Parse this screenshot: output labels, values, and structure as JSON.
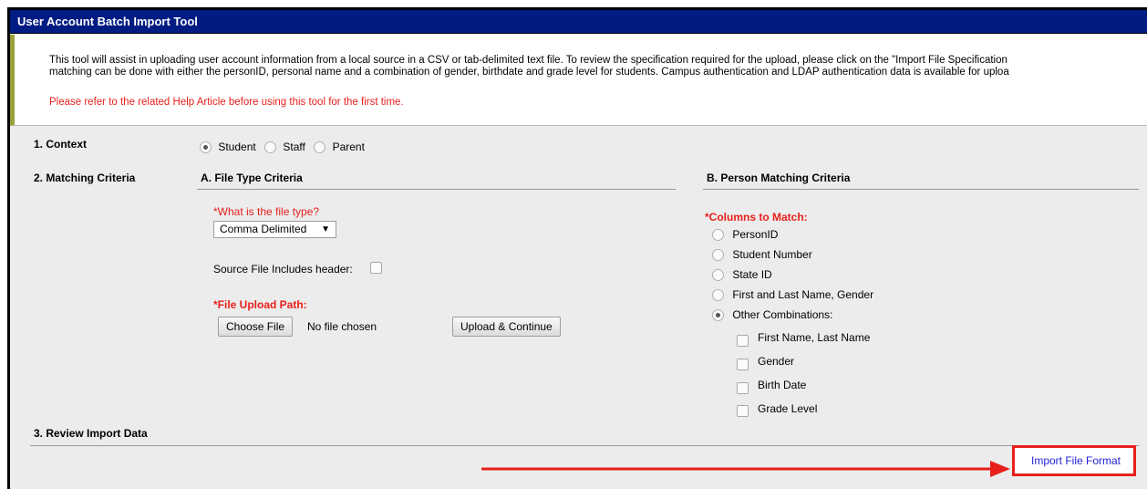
{
  "window": {
    "title": "User Account Batch Import Tool"
  },
  "intro": {
    "line1": "This tool will assist in uploading user account information from a local source in a CSV or tab-delimited text file. To review the specification required for the upload, please click on the \"Import File Specification",
    "line2": "matching can be done with either the personID, personal name and a combination of gender, birthdate and grade level for students. Campus authentication and LDAP authentication data is available for uploa",
    "help_note": "Please refer to the related Help Article before using this tool for the first time."
  },
  "context": {
    "label": "1. Context",
    "options": [
      "Student",
      "Staff",
      "Parent"
    ],
    "selected": "Student"
  },
  "matching": {
    "label": "2. Matching Criteria",
    "file_type": {
      "heading": "A. File Type Criteria",
      "question": "*What is the file type?",
      "selected": "Comma Delimited",
      "header_label": "Source File Includes header:",
      "upload_label": "*File Upload Path:",
      "choose_label": "Choose File",
      "no_file_text": "No file chosen",
      "upload_button": "Upload & Continue"
    },
    "person": {
      "heading": "B. Person Matching Criteria",
      "columns_label": "*Columns to Match:",
      "options": [
        "PersonID",
        "Student Number",
        "State ID",
        "First and Last Name, Gender",
        "Other Combinations:"
      ],
      "selected": "Other Combinations:",
      "combinations": [
        "First Name, Last Name",
        "Gender",
        "Birth Date",
        "Grade Level"
      ]
    }
  },
  "review": {
    "label": "3. Review Import Data"
  },
  "footer": {
    "import_format_link": "Import File Format"
  },
  "colors": {
    "titlebar": "#001c82",
    "required_red": "#e8201b",
    "annotation_red": "#e8201b",
    "link_blue": "#1f1fd6"
  }
}
